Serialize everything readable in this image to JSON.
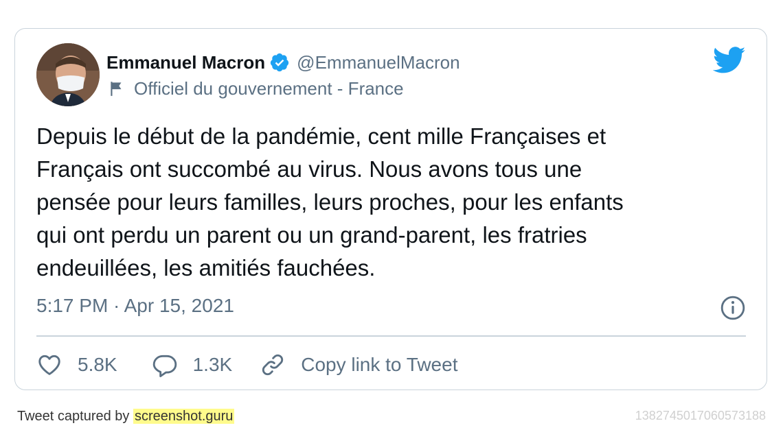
{
  "tweet": {
    "author": {
      "display_name": "Emmanuel Macron",
      "handle": "@EmmanuelMacron",
      "verified": true,
      "label": "Officiel du gouvernement - France"
    },
    "text": "Depuis le début de la pandémie, cent mille Françaises et\nFrançais ont succombé au virus. Nous avons tous une\npensée pour leurs familles, leurs proches, pour les enfants\nqui ont perdu un parent ou un grand-parent, les fratries\nendeuillées, les amitiés fauchées.",
    "timestamp": "5:17 PM · Apr 15, 2021",
    "actions": {
      "likes": "5.8K",
      "replies": "1.3K",
      "copy_link": "Copy link to Tweet"
    }
  },
  "footer": {
    "captured_by": "Tweet captured by ",
    "site": "screenshot.guru",
    "tweet_id": "1382745017060573188"
  },
  "colors": {
    "brand_blue": "#1da1f2",
    "secondary_text": "#5b7083",
    "border": "#c9d3db",
    "highlight": "#fffb8c"
  },
  "icons": {
    "bird": "twitter-bird-icon",
    "verified": "verified-badge-icon",
    "flag": "flag-icon",
    "info": "info-icon",
    "like": "heart-icon",
    "reply": "reply-icon",
    "link": "link-icon"
  }
}
